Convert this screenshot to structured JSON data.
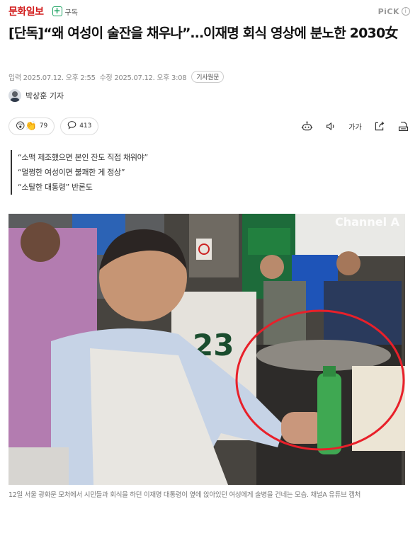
{
  "header": {
    "brand": "문화일보",
    "subscribe_label": "구독",
    "pick_label": "PiCK",
    "pick_info_glyph": "i"
  },
  "article": {
    "title": "[단독]“왜 여성이 술잔을 채우나”…이재명 회식 영상에 분노한 2030女",
    "input_time": "입력 2025.07.12. 오후 2:55",
    "edit_time": "수정 2025.07.12. 오후 3:08",
    "original_button": "기사원문",
    "reporter": "박상훈 기자",
    "summary": [
      "“소맥 제조했으면 본인 잔도 직접 채워야”",
      "“멀쩡한 여성이면 불쾌한 게 정상”",
      "“소탈한 대통령” 반론도"
    ],
    "photo_overlay_text": "Channel A",
    "caption": "12일 서울 광화문 모처에서 시민들과 회식을 하던 이재명 대통령이 옆에 앉아있던 여성에게 술병을 건네는 모습. 채널A 유튜브 캡처"
  },
  "actions": {
    "reaction_count": "79",
    "comment_count": "413",
    "font_size_label": "가가",
    "icons": [
      "reaction-icon",
      "comment-icon",
      "summary-bot-icon",
      "audio-icon",
      "font-size-icon",
      "share-icon",
      "print-icon"
    ]
  },
  "colors": {
    "brand_red": "#d21d1d",
    "subscribe_green": "#1aa260",
    "highlight_circle": "#e8202a"
  }
}
